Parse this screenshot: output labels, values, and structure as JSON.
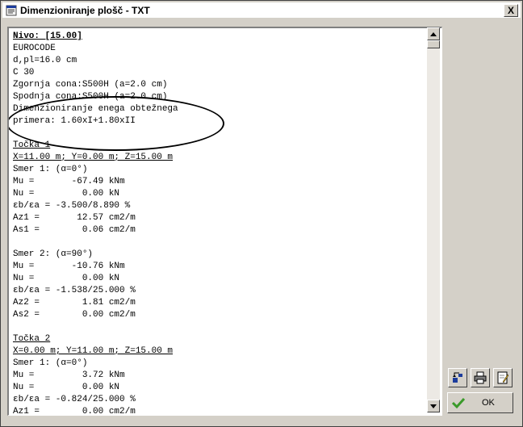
{
  "window": {
    "title": "Dimenzioniranje plošč - TXT",
    "close_label": "X"
  },
  "document": {
    "lines": [
      {
        "text": "Nivo: [15.00]",
        "style": "bold-u"
      },
      {
        "text": "EUROCODE"
      },
      {
        "text": "d,pl=16.0 cm"
      },
      {
        "text": "C 30"
      },
      {
        "text": "Zgornja cona:S500H (a=2.0 cm)"
      },
      {
        "text": "Spodnja cona:S500H (a=2.0 cm)"
      },
      {
        "text": "Dimenzioniranje enega obtežnega"
      },
      {
        "text": "primera: 1.60xI+1.80xII"
      },
      {
        "text": ""
      },
      {
        "text": "Točka 1",
        "style": "u"
      },
      {
        "text": "X=11.00 m; Y=0.00 m; Z=15.00 m",
        "style": "u"
      },
      {
        "text": "Smer 1: (α=0°)"
      },
      {
        "text": "Mu =       -67.49 kNm"
      },
      {
        "text": "Nu =         0.00 kN"
      },
      {
        "text": "εb/εa = -3.500/8.890 %"
      },
      {
        "text": "Az1 =       12.57 cm2/m"
      },
      {
        "text": "As1 =        0.06 cm2/m"
      },
      {
        "text": ""
      },
      {
        "text": "Smer 2: (α=90°)"
      },
      {
        "text": "Mu =       -10.76 kNm"
      },
      {
        "text": "Nu =         0.00 kN"
      },
      {
        "text": "εb/εa = -1.538/25.000 %"
      },
      {
        "text": "Az2 =        1.81 cm2/m"
      },
      {
        "text": "As2 =        0.00 cm2/m"
      },
      {
        "text": ""
      },
      {
        "text": "Točka 2",
        "style": "u"
      },
      {
        "text": "X=0.00 m; Y=11.00 m; Z=15.00 m",
        "style": "u"
      },
      {
        "text": "Smer 1: (α=0°)"
      },
      {
        "text": "Mu =         3.72 kNm"
      },
      {
        "text": "Nu =         0.00 kN"
      },
      {
        "text": "εb/εa = -0.824/25.000 %"
      },
      {
        "text": "Az1 =        0.00 cm2/m"
      }
    ]
  },
  "buttons": {
    "ok_label": "OK"
  },
  "icons": {
    "app": "document-icon",
    "scroll_up": "arrow-up-icon",
    "scroll_down": "arrow-down-icon",
    "tool1": "sort-icon",
    "tool2": "printer-icon",
    "tool3": "edit-icon",
    "ok": "checkmark-icon"
  },
  "colors": {
    "accent_green": "#3a9a2a",
    "highlight_blue": "#1c3c9c"
  }
}
